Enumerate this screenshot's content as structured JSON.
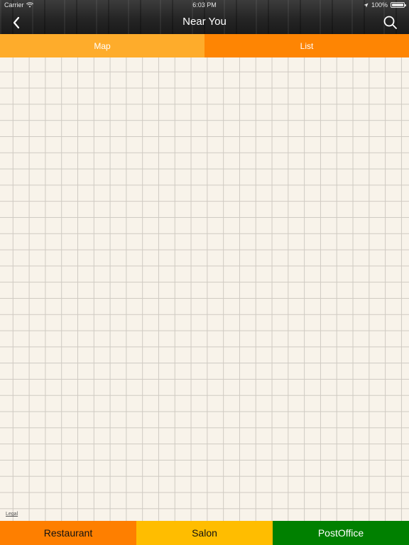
{
  "status_bar": {
    "carrier": "Carrier",
    "time": "6:03 PM",
    "battery": "100%"
  },
  "header": {
    "title": "Near You",
    "back_icon": "chevron-left-icon",
    "search_icon": "search-icon"
  },
  "tabs": {
    "map_label": "Map",
    "list_label": "List"
  },
  "map": {
    "legal_label": "Legal"
  },
  "categories": {
    "restaurant_label": "Restaurant",
    "salon_label": "Salon",
    "postoffice_label": "PostOffice"
  },
  "colors": {
    "tab_map": "#feac2b",
    "tab_list": "#fe8503",
    "restaurant": "#fe7f00",
    "salon": "#ffbd00",
    "postoffice": "#008000"
  }
}
